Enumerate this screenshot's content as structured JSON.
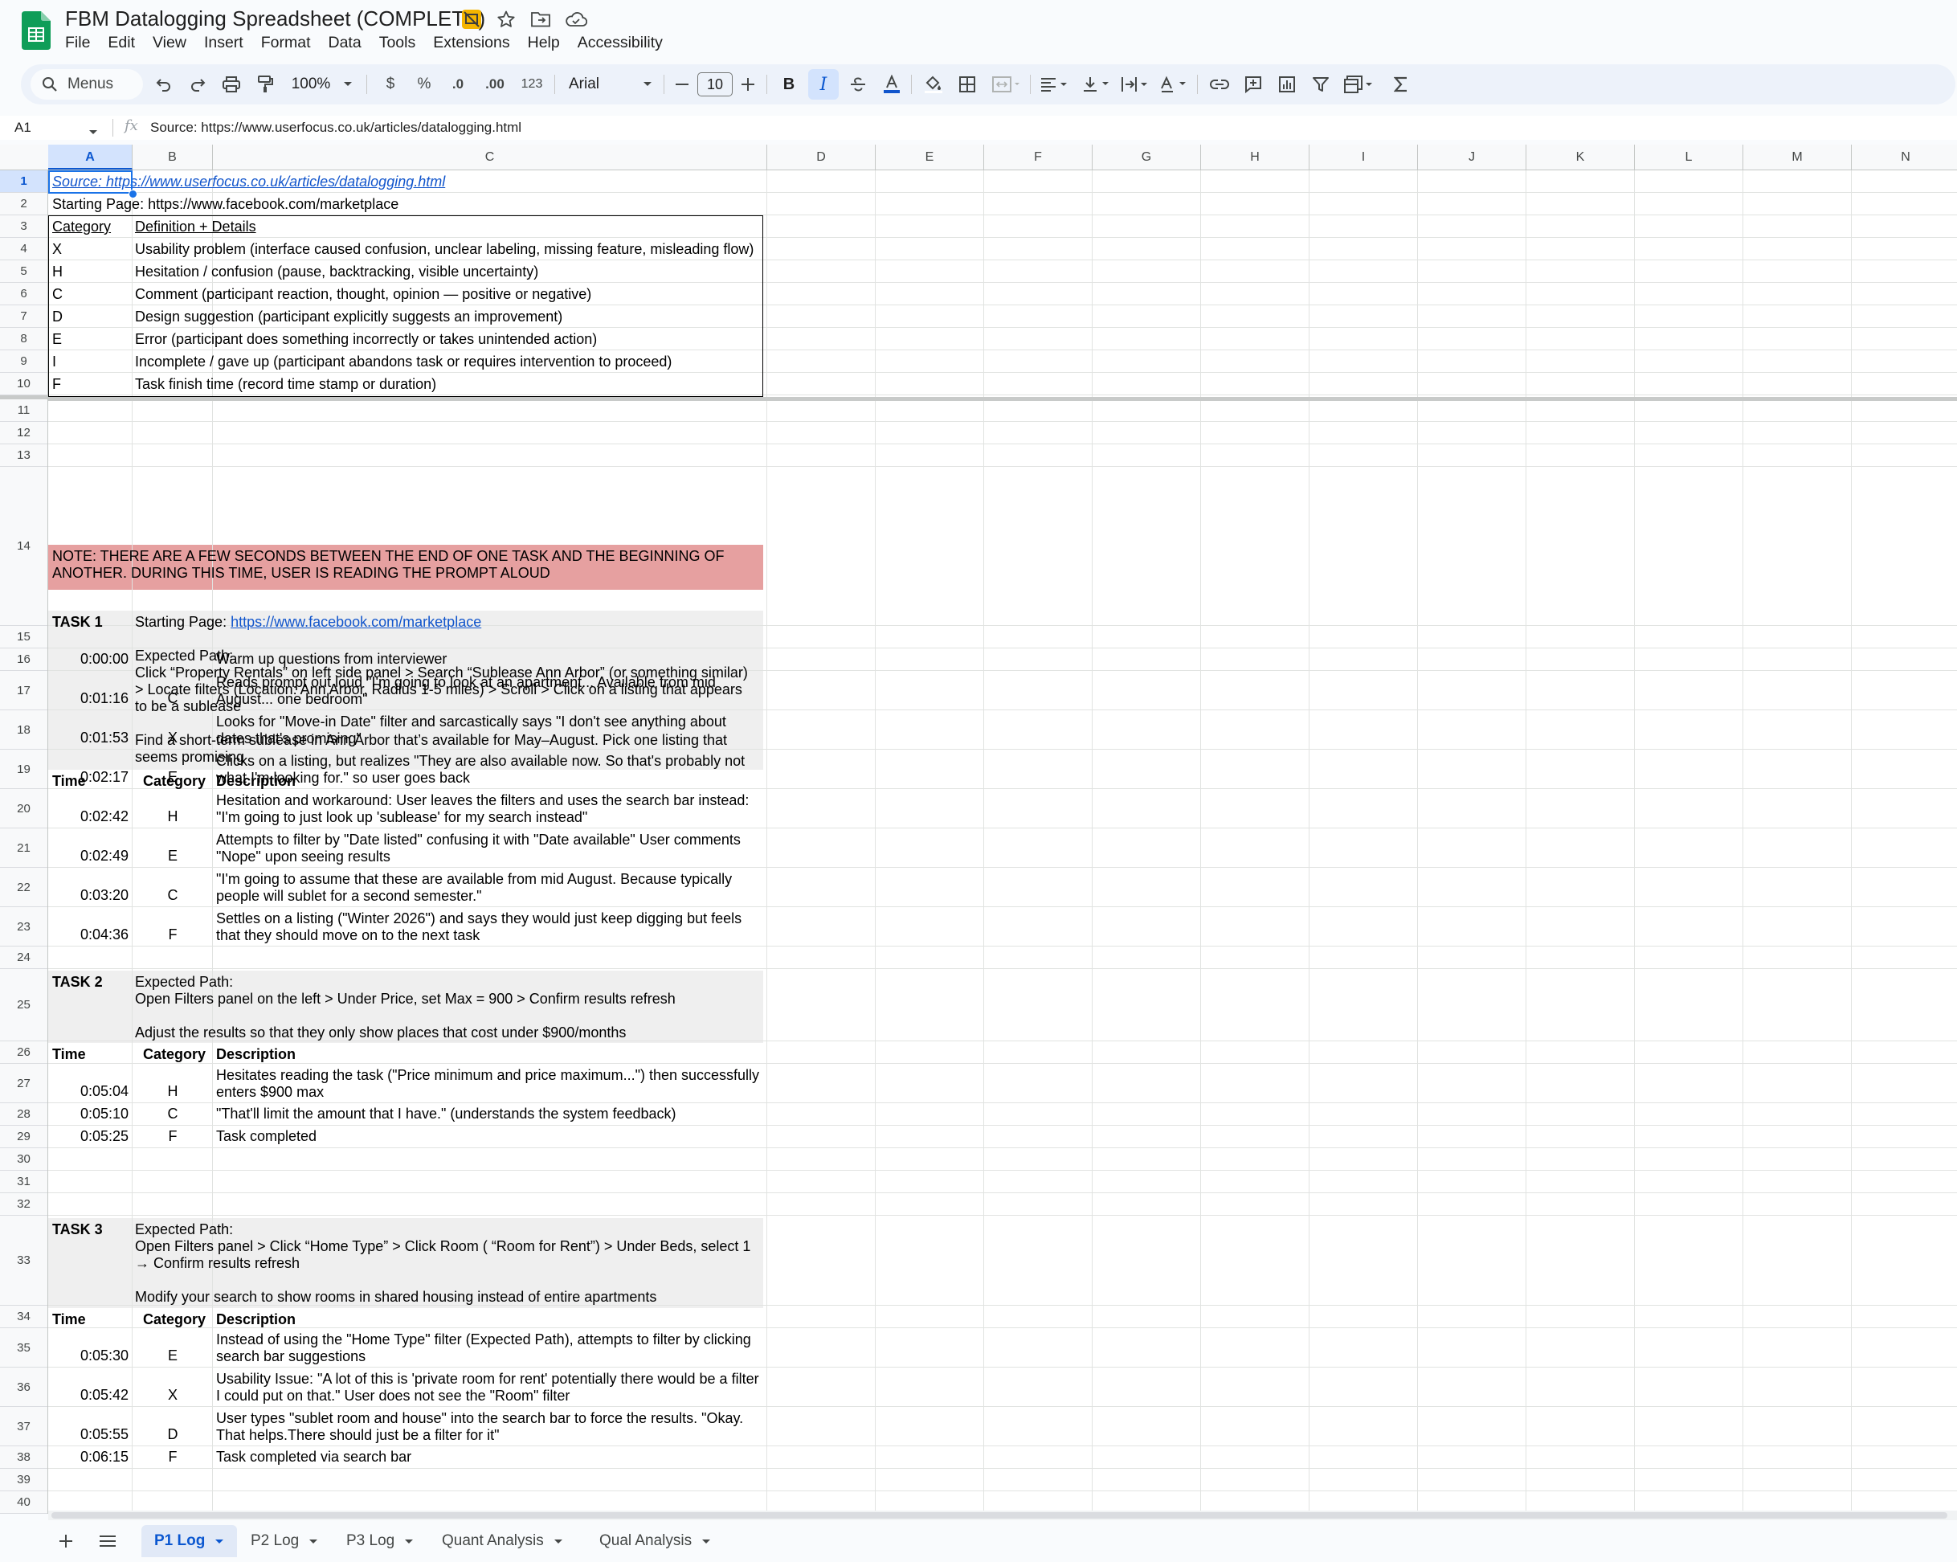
{
  "app": {
    "title": "FBM Datalogging Spreadsheet (COMPLETE)",
    "brand_color": "#0f9d58",
    "title_icons": [
      "slides-badge-icon",
      "star-icon",
      "move-folder-icon",
      "cloud-status-icon"
    ]
  },
  "menu": [
    "File",
    "Edit",
    "View",
    "Insert",
    "Format",
    "Data",
    "Tools",
    "Extensions",
    "Help",
    "Accessibility"
  ],
  "toolbar": {
    "search_label": "Menus",
    "zoom": "100%",
    "currency": "$",
    "percent": "%",
    "dec_decrease": ".0",
    "dec_increase": ".00",
    "number_format": "123",
    "font": "Arial",
    "font_size": "10",
    "bold": "B",
    "italic": "I",
    "italic_active": true
  },
  "formula_bar": {
    "cell_ref": "A1",
    "fx": "fx",
    "value": "Source: https://www.userfocus.co.uk/articles/datalogging.html"
  },
  "columns": [
    "A",
    "B",
    "C",
    "D",
    "E",
    "F",
    "G",
    "H",
    "I",
    "J",
    "K",
    "L",
    "M",
    "N"
  ],
  "selected_column": "A",
  "rows": [
    "1",
    "2",
    "3",
    "4",
    "5",
    "6",
    "7",
    "8",
    "9",
    "10",
    "11",
    "12",
    "13",
    "14",
    "15",
    "16",
    "17",
    "18",
    "19",
    "20",
    "21",
    "22",
    "23",
    "24",
    "25",
    "26",
    "27",
    "28",
    "29",
    "30",
    "31",
    "32",
    "33",
    "34",
    "35",
    "36",
    "37",
    "38",
    "39",
    "40"
  ],
  "sheet": {
    "r1": "Source: https://www.userfocus.co.uk/articles/datalogging.html",
    "r2": "Starting Page: https://www.facebook.com/marketplace",
    "legend_header": {
      "category": "Category",
      "definition": "Definition + Details"
    },
    "legend": [
      {
        "code": "X",
        "text": "Usability problem (interface caused confusion, unclear labeling, missing feature, misleading flow)"
      },
      {
        "code": "H",
        "text": "Hesitation / confusion (pause, backtracking, visible uncertainty)"
      },
      {
        "code": "C",
        "text": "Comment (participant reaction, thought, opinion — positive or negative)"
      },
      {
        "code": "D",
        "text": "Design suggestion (participant explicitly suggests an improvement)"
      },
      {
        "code": "E",
        "text": "Error (participant does something incorrectly or takes unintended action)"
      },
      {
        "code": "I",
        "text": "Incomplete / gave up (participant abandons task or requires intervention to proceed)"
      },
      {
        "code": "F",
        "text": "Task finish time (record time stamp or duration)"
      }
    ],
    "note_line1": "NOTE: THERE ARE A FEW SECONDS BETWEEN THE END OF ONE TASK AND THE BEGINNING OF",
    "note_line2": "ANOTHER. DURING THIS TIME, USER IS READING THE PROMPT ALOUD",
    "note_color": "#e6a0a0",
    "table_headers": {
      "time": "Time",
      "category": "Category",
      "description": "Description"
    },
    "task1": {
      "label": "TASK 1",
      "starting_prefix": "Starting Page: ",
      "starting_link": "https://www.facebook.com/marketplace",
      "expected_label": "Expected Path:",
      "expected": "Click “Property Rentals” on left side panel > Search “Sublease Ann Arbor” (or something similar) > Locate filters (Location: Ann Arbor, Radius 1-5 miles) > Scroll > Click on a listing that appears to be a sublease",
      "prompt": "Find a short-term sublease in Ann Arbor that’s available for May–August. Pick one listing that seems promising",
      "log": [
        {
          "time": "0:00:00",
          "cat": "",
          "desc": "Warm up questions from interviewer"
        },
        {
          "time": "0:01:16",
          "cat": "C",
          "desc": "Reads prompt out loud \"I'm going to look at an apartment... Available from mid August... one bedroom\""
        },
        {
          "time": "0:01:53",
          "cat": "X",
          "desc": "Looks for \"Move-in Date\" filter and sarcastically says \"I don't see anything about dates that's promising\""
        },
        {
          "time": "0:02:17",
          "cat": "E",
          "desc": "Clicks on a listing, but realizes \"They are also available now. So that's probably not what I'm looking for.\" so user goes back"
        },
        {
          "time": "0:02:42",
          "cat": "H",
          "desc": "Hesitation and workaround: User leaves the filters and uses the search bar instead: \"I'm going to just look up 'sublease' for my search instead\""
        },
        {
          "time": "0:02:49",
          "cat": "E",
          "desc": "Attempts to filter by \"Date listed\" confusing it with \"Date available\" User comments \"Nope\" upon seeing results"
        },
        {
          "time": "0:03:20",
          "cat": "C",
          "desc": "\"I'm going to assume that these are available from mid August. Because typically people will sublet for a second semester.\""
        },
        {
          "time": "0:04:36",
          "cat": "F",
          "desc": "Settles on a listing (\"Winter 2026\") and says they would just keep digging but feels that they should move on to the next task"
        }
      ]
    },
    "task2": {
      "label": "TASK 2",
      "expected_label": "Expected Path:",
      "expected": "Open Filters panel on the left > Under Price, set Max = 900 > Confirm results refresh",
      "prompt": "Adjust the results so that they only show places that cost under $900/months",
      "log": [
        {
          "time": "0:05:04",
          "cat": "H",
          "desc": "Hesitates reading the task (\"Price minimum and price maximum...\") then successfully enters $900 max"
        },
        {
          "time": "0:05:10",
          "cat": "C",
          "desc": "\"That'll limit the amount that I have.\" (understands the system feedback)"
        },
        {
          "time": "0:05:25",
          "cat": "F",
          "desc": "Task completed"
        }
      ]
    },
    "task3": {
      "label": "TASK 3",
      "expected_label": "Expected Path:",
      "expected": "Open Filters panel > Click “Home Type” > Click Room ( “Room for Rent”) > Under Beds, select 1 → Confirm results refresh",
      "prompt": "Modify your search to show rooms in shared housing instead of entire apartments",
      "log": [
        {
          "time": "0:05:30",
          "cat": "E",
          "desc": "Instead of using the \"Home Type\" filter (Expected Path), attempts to filter by clicking search bar suggestions"
        },
        {
          "time": "0:05:42",
          "cat": "X",
          "desc": "Usability Issue: \"A lot of this is 'private room for rent' potentially there would be a filter I could put on that.\" User does not see the \"Room\" filter"
        },
        {
          "time": "0:05:55",
          "cat": "D",
          "desc": "User types \"sublet room and house\" into the search bar to force the results. \"Okay. That helps.There should just be a filter for it\""
        },
        {
          "time": "0:06:15",
          "cat": "F",
          "desc": "Task completed via search bar"
        }
      ]
    }
  },
  "sheet_tabs": [
    {
      "name": "P1 Log",
      "active": true
    },
    {
      "name": "P2 Log",
      "active": false
    },
    {
      "name": "P3 Log",
      "active": false
    },
    {
      "name": "Quant Analysis",
      "active": false
    },
    {
      "name": "Qual Analysis",
      "active": false
    }
  ]
}
